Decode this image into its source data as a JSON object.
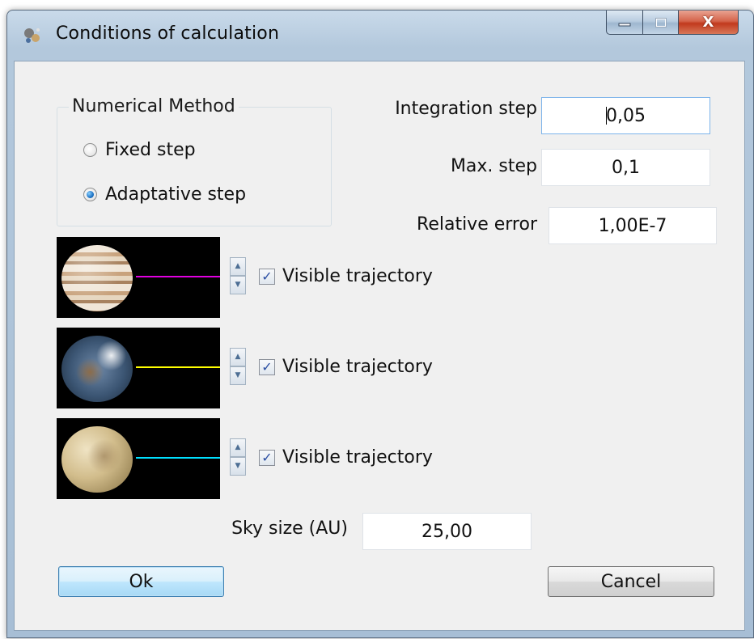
{
  "window": {
    "title": "Conditions of calculation",
    "icon": "planet-app-icon",
    "caption_icons": [
      "minimize-icon",
      "maximize-icon",
      "close-icon"
    ]
  },
  "numerical_method": {
    "title": "Numerical Method",
    "options": [
      {
        "label": "Fixed step",
        "checked": false
      },
      {
        "label": "Adaptative step",
        "checked": true
      }
    ]
  },
  "fields": {
    "integration_step": {
      "label": "Integration step",
      "value": "0,05"
    },
    "max_step": {
      "label": "Max. step",
      "value": "0,1"
    },
    "relative_error": {
      "label": "Relative error",
      "value": "1,00E-7"
    },
    "sky_size": {
      "label": "Sky size (AU)",
      "value": "25,00"
    }
  },
  "bodies": [
    {
      "icon": "jupiter-icon",
      "trajectory_color": "#e000e0",
      "visible_label": "Visible trajectory",
      "checked": true
    },
    {
      "icon": "earth-icon",
      "trajectory_color": "#ffff00",
      "visible_label": "Visible trajectory",
      "checked": true
    },
    {
      "icon": "moon-icon",
      "trajectory_color": "#00e0ff",
      "visible_label": "Visible trajectory",
      "checked": true
    }
  ],
  "buttons": {
    "ok": "Ok",
    "cancel": "Cancel",
    "close_glyph": "X"
  }
}
